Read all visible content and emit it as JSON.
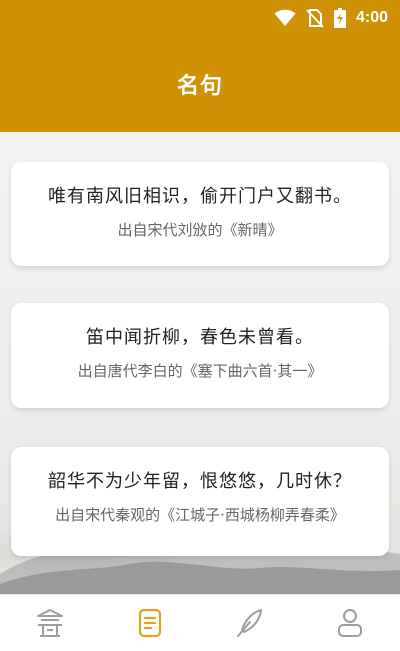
{
  "status_bar": {
    "time": "4:00",
    "icons": [
      "wifi-icon",
      "no-sim-icon",
      "battery-charging-icon"
    ]
  },
  "app_bar": {
    "title": "名句"
  },
  "quotes": [
    {
      "text": "唯有南风旧相识，偷开门户又翻书。",
      "source": "出自宋代刘攽的《新晴》"
    },
    {
      "text": "笛中闻折柳，春色未曾看。",
      "source": "出自唐代李白的《塞下曲六首·其一》"
    },
    {
      "text": "韶华不为少年留，恨悠悠，几时休？",
      "source": "出自宋代秦观的《江城子·西城杨柳弄春柔》"
    }
  ],
  "bottom_nav": {
    "items": [
      {
        "icon": "pavilion-icon",
        "active": false
      },
      {
        "icon": "document-icon",
        "active": true
      },
      {
        "icon": "quill-pen-icon",
        "active": false
      },
      {
        "icon": "profile-icon",
        "active": false
      }
    ],
    "active_color": "#e0a31a",
    "inactive_color": "#9e9e9e"
  },
  "colors": {
    "accent": "#cf9106"
  }
}
